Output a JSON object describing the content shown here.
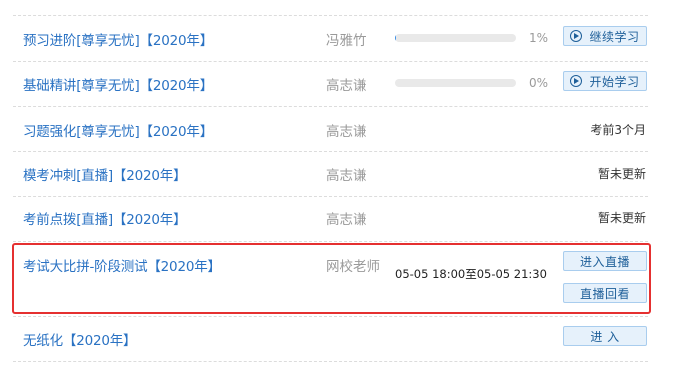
{
  "courses": [
    {
      "title": "预习进阶[尊享无忧]【2020年】",
      "teacher": "冯雅竹",
      "progress_percent": 1,
      "progress_label": "1%",
      "action": "继续学习",
      "action_icon": "play-circle-icon"
    },
    {
      "title": "基础精讲[尊享无忧]【2020年】",
      "teacher": "高志谦",
      "progress_percent": 0,
      "progress_label": "0%",
      "action": "开始学习",
      "action_icon": "play-circle-icon"
    },
    {
      "title": "习题强化[尊享无忧]【2020年】",
      "teacher": "高志谦",
      "status": "考前3个月"
    },
    {
      "title": "模考冲刺[直播]【2020年】",
      "teacher": "高志谦",
      "status": "暂未更新"
    },
    {
      "title": "考前点拨[直播]【2020年】",
      "teacher": "高志谦",
      "status": "暂未更新"
    },
    {
      "title": "考试大比拼-阶段测试【2020年】",
      "teacher": "网校老师",
      "schedule": "05-05 18:00至05-05 21:30",
      "actions": [
        "进入直播",
        "直播回看"
      ],
      "highlight_color": "#e53030"
    },
    {
      "title": "无纸化【2020年】",
      "action": "进 入"
    }
  ],
  "colors": {
    "link": "#2a72c3",
    "button_bg": "#e6f1fb",
    "button_border": "#a9cdee",
    "progress": "#3a8ee6"
  }
}
